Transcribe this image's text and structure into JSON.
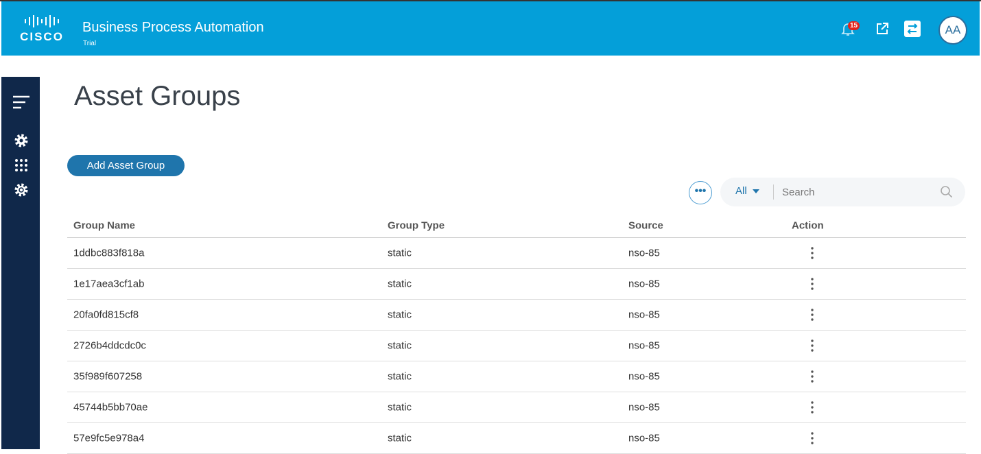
{
  "header": {
    "brand": "CISCO",
    "title": "Business Process Automation",
    "subtitle": "Trial",
    "notification_count": "15",
    "avatar_initials": "AA"
  },
  "sidebar": {
    "icons": [
      "menu-icon",
      "settings-icon",
      "apps-grid-icon",
      "admin-gear-icon"
    ]
  },
  "page": {
    "title": "Asset Groups",
    "add_button": "Add Asset Group"
  },
  "toolbar": {
    "filter_value": "All",
    "search_placeholder": "Search"
  },
  "table": {
    "columns": [
      "Group Name",
      "Group Type",
      "Source",
      "Action"
    ],
    "rows": [
      {
        "name": "1ddbc883f818a",
        "type": "static",
        "source": "nso-85"
      },
      {
        "name": "1e17aea3cf1ab",
        "type": "static",
        "source": "nso-85"
      },
      {
        "name": "20fa0fd815cf8",
        "type": "static",
        "source": "nso-85"
      },
      {
        "name": "2726b4ddcdc0c",
        "type": "static",
        "source": "nso-85"
      },
      {
        "name": "35f989f607258",
        "type": "static",
        "source": "nso-85"
      },
      {
        "name": "45744b5bb70ae",
        "type": "static",
        "source": "nso-85"
      },
      {
        "name": "57e9fc5e978a4",
        "type": "static",
        "source": "nso-85"
      }
    ]
  }
}
